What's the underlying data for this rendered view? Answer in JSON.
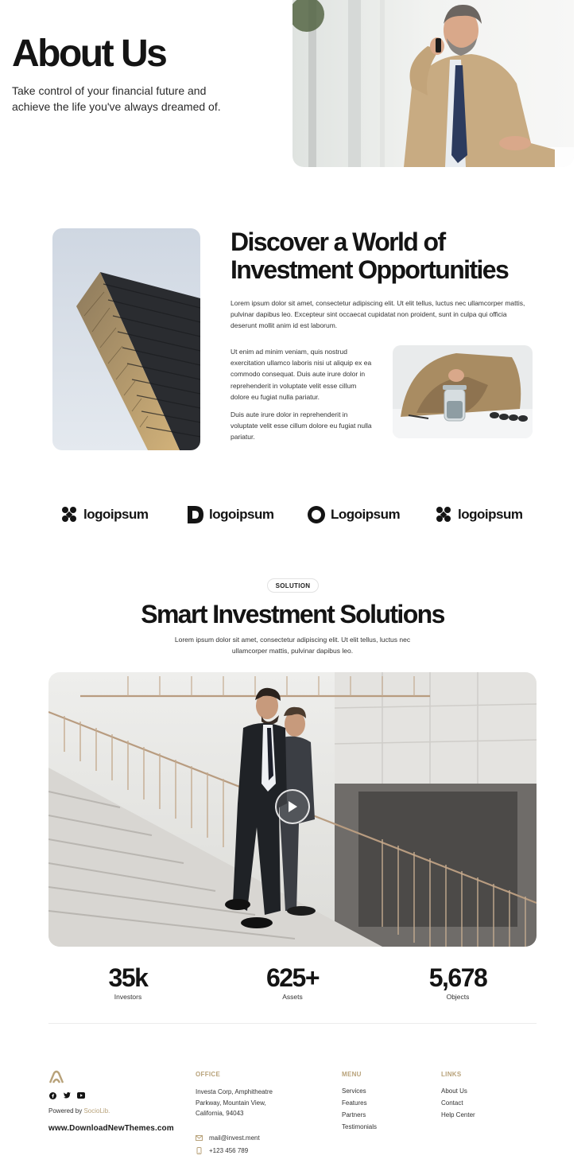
{
  "hero": {
    "title": "About Us",
    "subtitle": "Take control of your financial future and achieve the life you've always dreamed of."
  },
  "discover": {
    "title": "Discover a World of Investment Opportunities",
    "paragraph1": "Lorem ipsum dolor sit amet, consectetur adipiscing elit. Ut elit tellus, luctus nec ullamcorper mattis, pulvinar dapibus leo. Excepteur sint occaecat cupidatat non proident, sunt in culpa qui officia deserunt mollit anim id est laborum.",
    "paragraph2": "Ut enim ad minim veniam, quis nostrud exercitation ullamco laboris nisi ut aliquip ex ea commodo consequat. Duis aute irure dolor in reprehenderit in voluptate velit esse cillum dolore eu fugiat nulla pariatur.",
    "paragraph3": "Duis aute irure dolor in reprehenderit in voluptate velit esse cillum dolore eu fugiat nulla pariatur."
  },
  "logos": [
    {
      "text": "logoipsum",
      "icon": "blob-logo-icon"
    },
    {
      "text": "logoipsum",
      "icon": "d-logo-icon"
    },
    {
      "text": "Logoipsum",
      "icon": "gear-ring-logo-icon"
    },
    {
      "text": "logoipsum",
      "icon": "blob-logo-icon"
    }
  ],
  "solution": {
    "badge": "SOLUTION",
    "title": "Smart Investment Solutions",
    "subtitle": "Lorem ipsum dolor sit amet, consectetur adipiscing elit. Ut elit tellus, luctus nec ullamcorper mattis, pulvinar dapibus leo."
  },
  "stats": [
    {
      "value": "35k",
      "label": "Investors"
    },
    {
      "value": "625+",
      "label": "Assets"
    },
    {
      "value": "5,678",
      "label": "Objects"
    }
  ],
  "footer": {
    "powered_prefix": "Powered by ",
    "powered_brand": "SocioLib.",
    "website": "www.DownloadNewThemes.com",
    "social": [
      "facebook-icon",
      "twitter-icon",
      "youtube-icon"
    ],
    "office": {
      "heading": "OFFICE",
      "address": "Investa Corp, Amphitheatre Parkway, Mountain View, California, 94043",
      "email": "mail@invest.ment",
      "phone": "+123 456 789"
    },
    "menu": {
      "heading": "MENU",
      "items": [
        "Services",
        "Features",
        "Partners",
        "Testimonials"
      ]
    },
    "links": {
      "heading": "LINKS",
      "items": [
        "About Us",
        "Contact",
        "Help Center"
      ]
    }
  },
  "colors": {
    "accent": "#b8a27a",
    "text": "#141414",
    "background": "#ffffff"
  }
}
